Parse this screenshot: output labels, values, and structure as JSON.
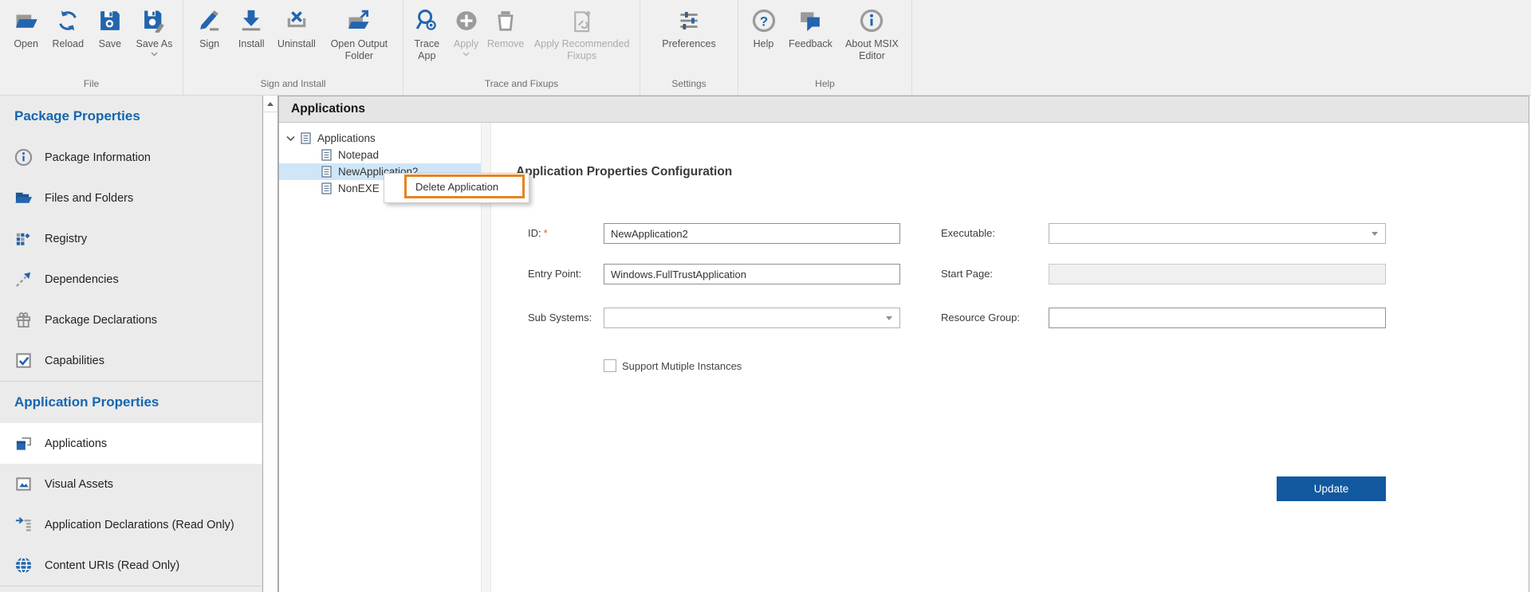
{
  "ribbon": {
    "groups": [
      {
        "label": "File",
        "buttons": [
          {
            "label": "Open",
            "enabled": true,
            "dropdown": false
          },
          {
            "label": "Reload",
            "enabled": true,
            "dropdown": false
          },
          {
            "label": "Save",
            "enabled": true,
            "dropdown": false
          },
          {
            "label": "Save As",
            "enabled": true,
            "dropdown": true
          }
        ]
      },
      {
        "label": "Sign and Install",
        "buttons": [
          {
            "label": "Sign",
            "enabled": true,
            "dropdown": false
          },
          {
            "label": "Install",
            "enabled": true,
            "dropdown": false
          },
          {
            "label": "Uninstall",
            "enabled": true,
            "dropdown": false
          },
          {
            "label": "Open Output Folder",
            "enabled": true,
            "dropdown": false
          }
        ]
      },
      {
        "label": "Trace and Fixups",
        "buttons": [
          {
            "label": "Trace App",
            "enabled": true,
            "dropdown": false
          },
          {
            "label": "Apply",
            "enabled": false,
            "dropdown": true
          },
          {
            "label": "Remove",
            "enabled": false,
            "dropdown": false
          },
          {
            "label": "Apply Recommended Fixups",
            "enabled": false,
            "dropdown": false
          }
        ]
      },
      {
        "label": "Settings",
        "buttons": [
          {
            "label": "Preferences",
            "enabled": true,
            "dropdown": false
          }
        ]
      },
      {
        "label": "Help",
        "buttons": [
          {
            "label": "Help",
            "enabled": true,
            "dropdown": false
          },
          {
            "label": "Feedback",
            "enabled": true,
            "dropdown": false
          },
          {
            "label": "About MSIX Editor",
            "enabled": true,
            "dropdown": false
          }
        ]
      }
    ]
  },
  "sidebar": {
    "sections": [
      {
        "heading": "Package Properties",
        "items": [
          {
            "label": "Package Information",
            "icon": "info-icon",
            "selected": false
          },
          {
            "label": "Files and Folders",
            "icon": "folder-icon",
            "selected": false
          },
          {
            "label": "Registry",
            "icon": "registry-icon",
            "selected": false
          },
          {
            "label": "Dependencies",
            "icon": "dependencies-icon",
            "selected": false
          },
          {
            "label": "Package Declarations",
            "icon": "gift-icon",
            "selected": false
          },
          {
            "label": "Capabilities",
            "icon": "checkbox-check-icon",
            "selected": false
          }
        ]
      },
      {
        "heading": "Application Properties",
        "items": [
          {
            "label": "Applications",
            "icon": "app-window-icon",
            "selected": true
          },
          {
            "label": "Visual Assets",
            "icon": "image-icon",
            "selected": false
          },
          {
            "label": "Application Declarations (Read Only)",
            "icon": "arrow-list-icon",
            "selected": false
          },
          {
            "label": "Content URIs (Read Only)",
            "icon": "globe-icon",
            "selected": false
          }
        ]
      }
    ]
  },
  "main": {
    "header_title": "Applications",
    "tree": {
      "root_label": "Applications",
      "children": [
        {
          "label": "Notepad",
          "selected": false
        },
        {
          "label": "NewApplication2",
          "selected": true
        },
        {
          "label": "NonEXE",
          "selected": false
        }
      ]
    },
    "context_menu": {
      "items": [
        {
          "label": "Delete Application",
          "highlighted": true
        }
      ]
    },
    "form": {
      "heading": "Application Properties Configuration",
      "fields": {
        "id": {
          "label": "ID:",
          "required_marker": "*",
          "value": "NewApplication2",
          "type": "text"
        },
        "executable": {
          "label": "Executable:",
          "value": "",
          "type": "combo"
        },
        "entry_point": {
          "label": "Entry Point:",
          "value": "Windows.FullTrustApplication",
          "type": "text"
        },
        "start_page": {
          "label": "Start Page:",
          "value": "",
          "type": "text",
          "disabled": true
        },
        "sub_systems": {
          "label": "Sub Systems:",
          "value": "",
          "type": "combo"
        },
        "resource_group": {
          "label": "Resource Group:",
          "value": "",
          "type": "text"
        }
      },
      "checkbox": {
        "label": "Support Mutiple Instances",
        "checked": false
      },
      "update_button_label": "Update"
    }
  },
  "colors": {
    "accent_blue": "#1566b0",
    "icon_blue": "#2365ae",
    "button_blue": "#11589f",
    "highlight_orange": "#e8831e",
    "tree_selection_blue": "#cfe6f8",
    "ribbon_bg": "#f0f0f0",
    "sidebar_bg": "#ebebeb"
  }
}
